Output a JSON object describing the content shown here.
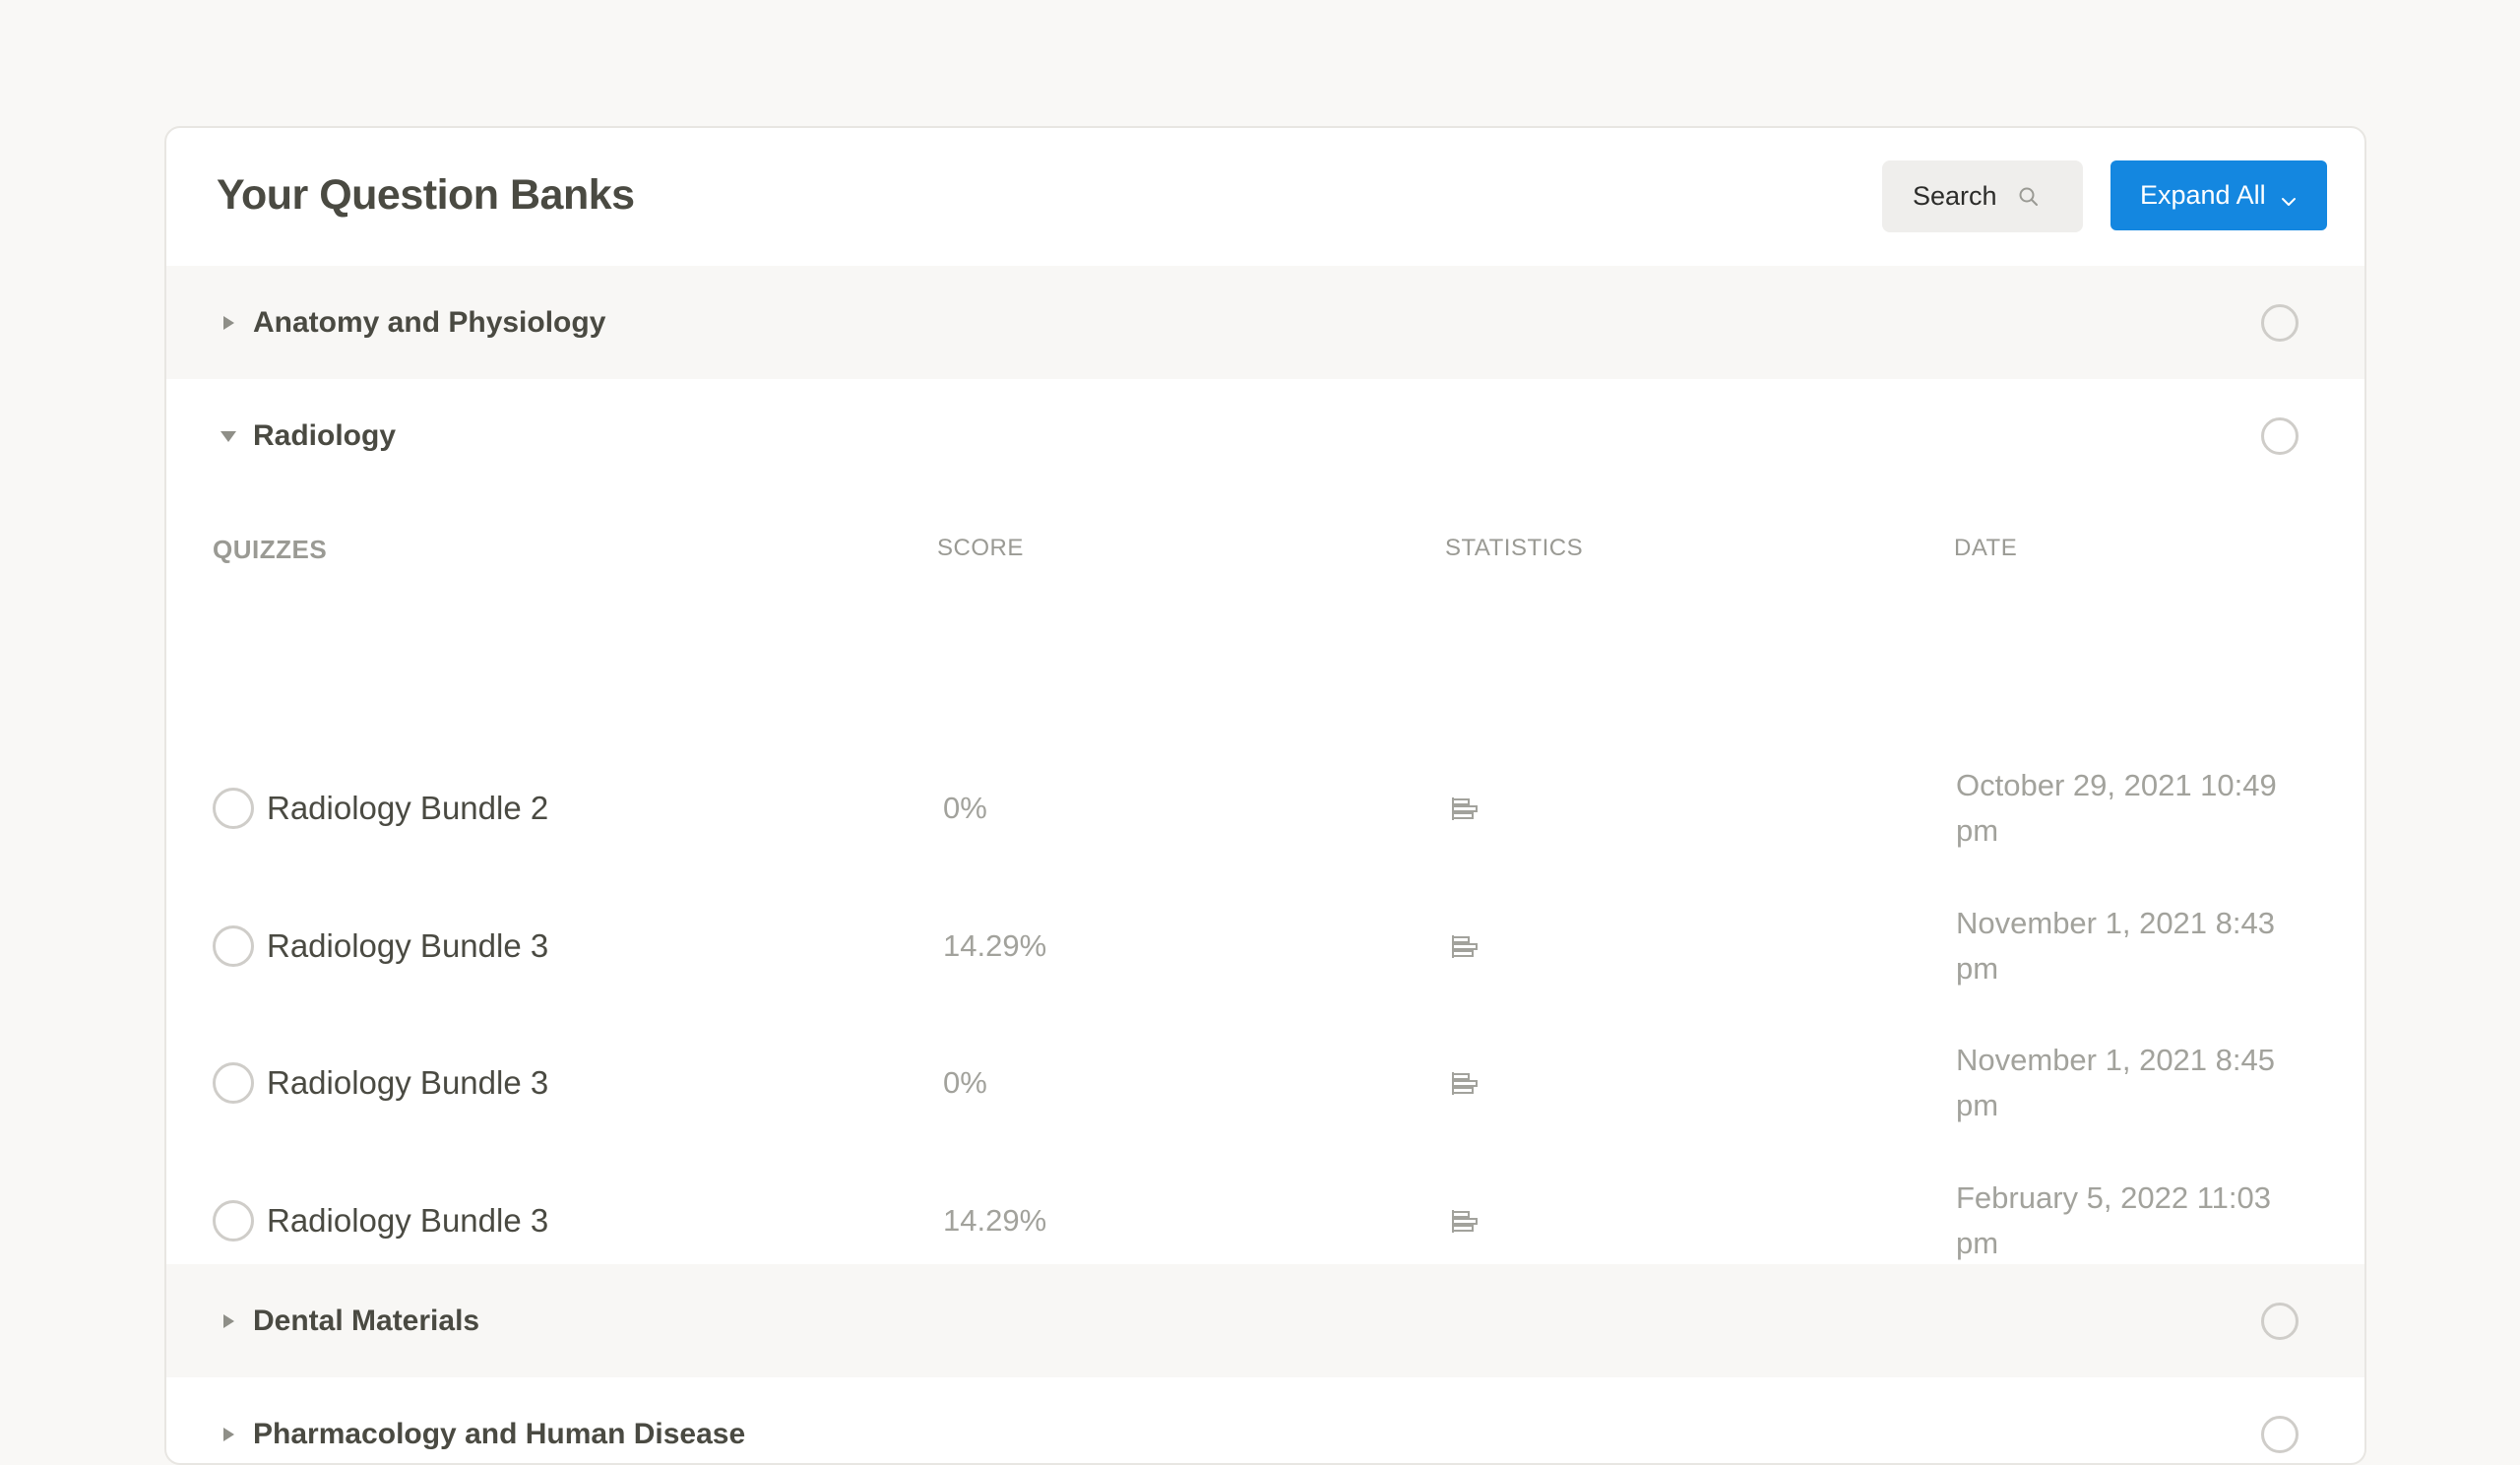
{
  "header": {
    "title": "Your Question Banks",
    "search_label": "Search",
    "expand_label": "Expand All"
  },
  "sections": [
    {
      "label": "Anatomy and Physiology",
      "expanded": false
    },
    {
      "label": "Radiology",
      "expanded": true
    },
    {
      "label": "Dental Materials",
      "expanded": false
    },
    {
      "label": "Pharmacology and Human Disease",
      "expanded": false
    }
  ],
  "table": {
    "headers": {
      "quizzes": "QUIZZES",
      "score": "SCORE",
      "statistics": "STATISTICS",
      "date": "DATE"
    },
    "rows": [
      {
        "name": "Radiology Bundle 2",
        "score": "0%",
        "date": "October 29, 2021 10:49 pm"
      },
      {
        "name": "Radiology Bundle 3",
        "score": "14.29%",
        "date": "November 1, 2021 8:43 pm"
      },
      {
        "name": "Radiology Bundle 3",
        "score": "0%",
        "date": "November 1, 2021 8:45 pm"
      },
      {
        "name": "Radiology Bundle 3",
        "score": "14.29%",
        "date": "February 5, 2022 11:03 pm"
      }
    ]
  },
  "icons": {
    "search": "search-icon",
    "expand": "chevron-down-icon",
    "collapsed_arrow": "triangle-right-icon",
    "expanded_arrow": "triangle-down-icon",
    "statistics": "statistics-icon"
  },
  "colors": {
    "accent": "#1487e0",
    "background": "#f9f8f6",
    "shaded_row": "#f8f7f5"
  }
}
